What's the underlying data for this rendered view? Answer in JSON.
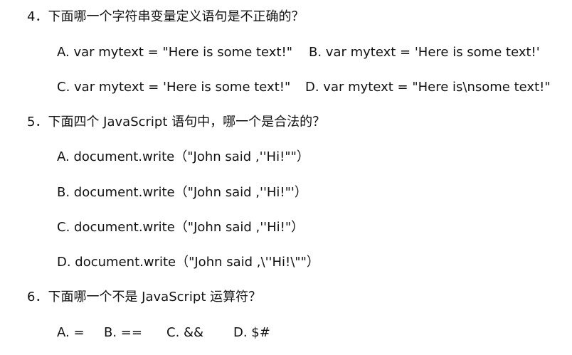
{
  "questions": [
    {
      "stem": "4．下面哪一个字符串变量定义语句是不正确的？",
      "options": {
        "a": "A. var mytext = \"Here is some text!\"",
        "b": "B. var mytext = 'Here is some text!'",
        "c": "C. var mytext = 'Here is some text!\"",
        "d": "D. var mytext = \"Here is\\nsome text!\""
      }
    },
    {
      "stem": "5．下面四个 JavaScript 语句中，哪一个是合法的？",
      "options": {
        "a": "A. document.write（\"John said ,''Hi!\"\"）",
        "b": "B. document.write（\"John said ,''Hi!\"'）",
        "c": "C. document.write（\"John said ,''Hi!\"）",
        "d": "D. document.write（\"John said ,\\''Hi!\\\"\"）"
      }
    },
    {
      "stem": "6．下面哪一个不是 JavaScript 运算符？",
      "options": {
        "a": "A. =",
        "b": "B. ==",
        "c": "C. &&",
        "d": "D. $#"
      }
    }
  ]
}
